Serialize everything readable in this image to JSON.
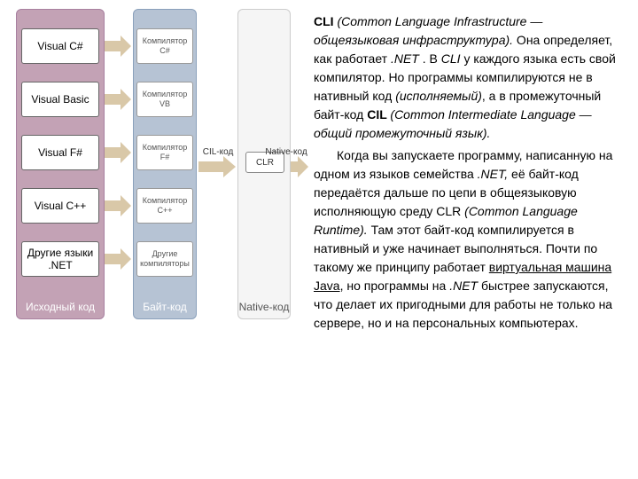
{
  "diagram": {
    "columns": {
      "source": "Исходный код",
      "byte": "Байт-код",
      "native": "Native-код"
    },
    "rows": [
      {
        "lang": "Visual C#",
        "compiler": "Компилятор C#"
      },
      {
        "lang": "Visual Basic",
        "compiler": "Компилятор VB"
      },
      {
        "lang": "Visual F#",
        "compiler": "Компилятор F#"
      },
      {
        "lang": "Visual C++",
        "compiler": "Компилятор C++"
      },
      {
        "lang": "Другие языки .NET",
        "compiler": "Другие компиляторы"
      }
    ],
    "cil_label": "CIL-код",
    "clr_label": "CLR",
    "native_label": "Native-код",
    "arrow_fill": "#d9c8a8",
    "arrow_stroke": "#b9a77f"
  },
  "text": {
    "p1a": "CLI ",
    "p1b": "(Common Language Infrastructure — общеязыковая инфраструктура).",
    "p1c": " Она определяет, как работает ",
    "p1d": ".NET",
    "p1e": " . В ",
    "p1f": "CLI",
    "p1g": " у каждого языка есть свой компилятор. Но программы компилируются не в нативный код ",
    "p1h": "(исполняемый)",
    "p1i": ", а в промежуточный байт-код ",
    "p1j": "CIL ",
    "p1k": "(Common Intermediate Language — общий промежуточный язык).",
    "p2a": "Когда вы запускаете программу, написанную на одном из языков семейства ",
    "p2b": ".NET,",
    "p2c": " её байт-код передаётся дальше по цепи в общеязыковую исполняющую среду CLR ",
    "p2d": "(Common Language Runtime).",
    "p2e": " Там этот байт-код компилируется в нативный и уже начинает выполняться. Почти по такому же принципу работает ",
    "p2f": "виртуальная машина Java",
    "p2g": ", но программы на ",
    "p2h": ".NET",
    "p2i": " быстрее запускаются, что делает их пригодными для работы не только на сервере, но и на персональных компьютерах."
  }
}
